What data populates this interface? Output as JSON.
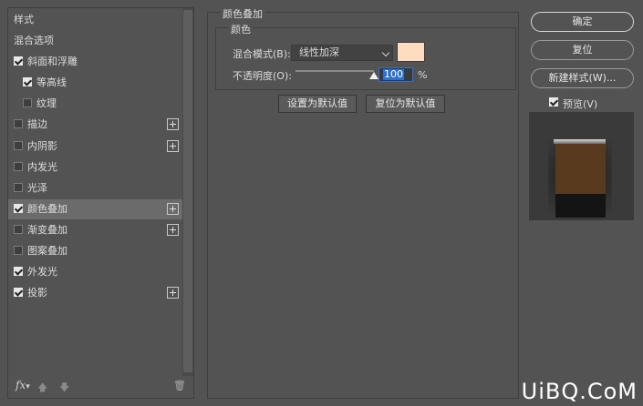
{
  "left_panel": {
    "header_label": "样式",
    "items": [
      {
        "label": "混合选项",
        "checkbox": false,
        "checked": false,
        "plus": false,
        "indent": false,
        "selected": false
      },
      {
        "label": "斜面和浮雕",
        "checkbox": true,
        "checked": true,
        "plus": false,
        "indent": false,
        "selected": false
      },
      {
        "label": "等高线",
        "checkbox": true,
        "checked": true,
        "plus": false,
        "indent": true,
        "selected": false
      },
      {
        "label": "纹理",
        "checkbox": true,
        "checked": false,
        "plus": false,
        "indent": true,
        "selected": false
      },
      {
        "label": "描边",
        "checkbox": true,
        "checked": false,
        "plus": true,
        "indent": false,
        "selected": false
      },
      {
        "label": "内阴影",
        "checkbox": true,
        "checked": false,
        "plus": true,
        "indent": false,
        "selected": false
      },
      {
        "label": "内发光",
        "checkbox": true,
        "checked": false,
        "plus": false,
        "indent": false,
        "selected": false
      },
      {
        "label": "光泽",
        "checkbox": true,
        "checked": false,
        "plus": false,
        "indent": false,
        "selected": false
      },
      {
        "label": "颜色叠加",
        "checkbox": true,
        "checked": true,
        "plus": true,
        "indent": false,
        "selected": true
      },
      {
        "label": "渐变叠加",
        "checkbox": true,
        "checked": false,
        "plus": true,
        "indent": false,
        "selected": false
      },
      {
        "label": "图案叠加",
        "checkbox": true,
        "checked": false,
        "plus": false,
        "indent": false,
        "selected": false
      },
      {
        "label": "外发光",
        "checkbox": true,
        "checked": true,
        "plus": false,
        "indent": false,
        "selected": false
      },
      {
        "label": "投影",
        "checkbox": true,
        "checked": true,
        "plus": true,
        "indent": false,
        "selected": false
      }
    ],
    "footer": {
      "fx_label": "fx"
    }
  },
  "color_overlay": {
    "group_title": "颜色叠加",
    "subgroup_title": "颜色",
    "blend_mode_label": "混合模式(B):",
    "blend_mode_value": "线性加深",
    "overlay_color": "#fddcc0",
    "opacity_label": "不透明度(O):",
    "opacity_value": "100",
    "opacity_fraction": 1.0,
    "opacity_unit": "%",
    "set_default_label": "设置为默认值",
    "reset_default_label": "复位为默认值"
  },
  "right_panel": {
    "ok_label": "确定",
    "reset_label": "复位",
    "new_style_label": "新建样式(W)...",
    "preview_label": "预览(V)",
    "preview_checked": true,
    "preview_swatch_color": "#5a3a1e"
  },
  "watermark": "UiBQ.CoM"
}
